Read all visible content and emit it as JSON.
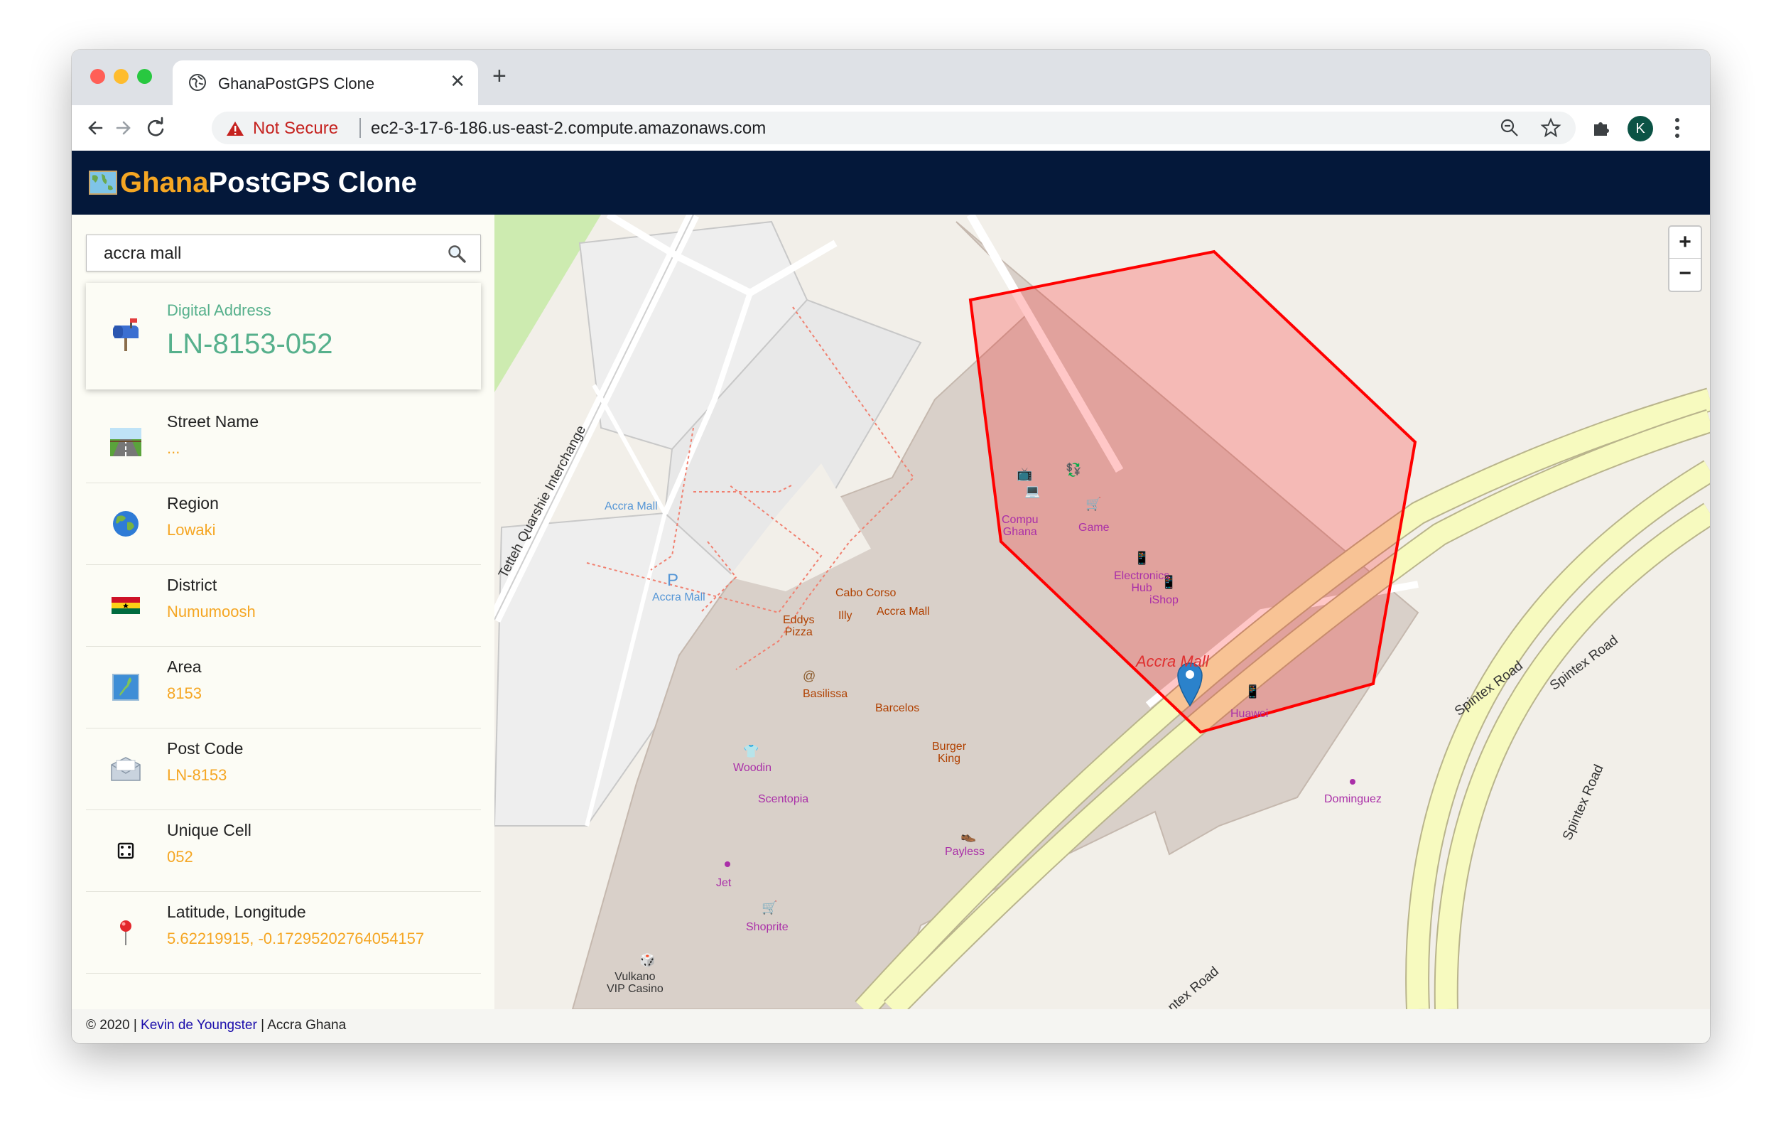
{
  "browser": {
    "tab_title": "GhanaPostGPS Clone",
    "security_label": "Not Secure",
    "url": "ec2-3-17-6-186.us-east-2.compute.amazonaws.com",
    "profile_initial": "K"
  },
  "app": {
    "title_part1": "Ghana",
    "title_part2": "PostGPS Clone"
  },
  "search": {
    "value": "accra mall"
  },
  "digital_address": {
    "label": "Digital Address",
    "value": "LN-8153-052"
  },
  "details": [
    {
      "label": "Street Name",
      "value": "...",
      "icon": "road-icon"
    },
    {
      "label": "Region",
      "value": "Lowaki",
      "icon": "globe-icon"
    },
    {
      "label": "District",
      "value": "Numumoosh",
      "icon": "ghana-flag-icon"
    },
    {
      "label": "Area",
      "value": "8153",
      "icon": "map-icon"
    },
    {
      "label": "Post Code",
      "value": "LN-8153",
      "icon": "envelope-icon"
    },
    {
      "label": "Unique Cell",
      "value": "052",
      "icon": "dice-icon"
    },
    {
      "label": "Latitude, Longitude",
      "value": "5.62219915, -0.17295202764054157",
      "icon": "pin-icon"
    }
  ],
  "map": {
    "zoom_in": "+",
    "zoom_out": "−",
    "labels": {
      "accra_mall_bus": "Accra Mall",
      "accra_mall_parking_p": "P",
      "accra_mall_parking": "Accra Mall",
      "tetteh_quarshie": "Tetteh Quarshie Interchange",
      "spintex_road": "Spintex Road",
      "spintex_road_partial": "ntex Road",
      "accra_mall_area": "Accra Mall",
      "compu_ghana": "Compu\nGhana",
      "game": "Game",
      "electronics_hub": "Electronics\nHub",
      "ishop": "iShop",
      "huawei": "Huawei",
      "cabo_corso": "Cabo Corso",
      "accra_mall_food": "Accra Mall",
      "eddys_pizza": "Eddys\nPizza",
      "illy": "Illy",
      "basilissa": "Basilissa",
      "barcelos": "Barcelos",
      "burger_king": "Burger\nKing",
      "woodin": "Woodin",
      "scentopia": "Scentopia",
      "dominguez": "Dominguez",
      "payless": "Payless",
      "jet": "Jet",
      "shoprite": "Shoprite",
      "vulkano": "Vulkano\nVIP Casino"
    }
  },
  "footer": {
    "prefix": "© 2020 | ",
    "author": "Kevin de Youngster",
    "suffix": " | Accra Ghana"
  },
  "colors": {
    "header_bg": "#04183a",
    "accent": "#f5a623",
    "digital_green": "#56b08c",
    "polygon": "#ff0000"
  }
}
